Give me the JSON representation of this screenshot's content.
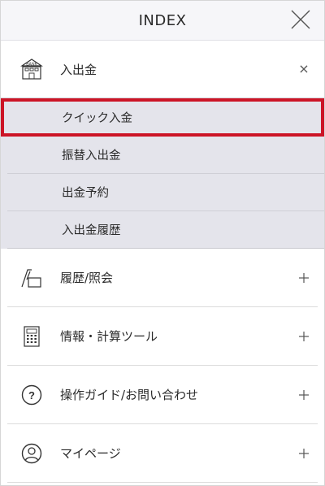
{
  "header": {
    "title": "INDEX",
    "close_icon": "close-icon"
  },
  "menu": {
    "deposit": {
      "icon": "bank-icon",
      "icon_text": "BANK",
      "label": "入出金",
      "toggle": "×",
      "sub_items": [
        {
          "label": "クイック入金",
          "active": true
        },
        {
          "label": "振替入出金"
        },
        {
          "label": "出金予約"
        },
        {
          "label": "入出金履歴"
        }
      ]
    },
    "history": {
      "icon": "document-history-icon",
      "label": "履歴/照会",
      "toggle": "+"
    },
    "info": {
      "icon": "calculator-icon",
      "label": "情報・計算ツール",
      "toggle": "+"
    },
    "guide": {
      "icon": "question-circle-icon",
      "label": "操作ガイド/お問い合わせ",
      "toggle": "+"
    },
    "mypage": {
      "icon": "user-circle-icon",
      "label": "マイページ",
      "toggle": "+"
    }
  },
  "colors": {
    "highlight_border": "#cc1426",
    "submenu_bg": "#e4e4eb",
    "header_bg": "#f6f6f9"
  }
}
